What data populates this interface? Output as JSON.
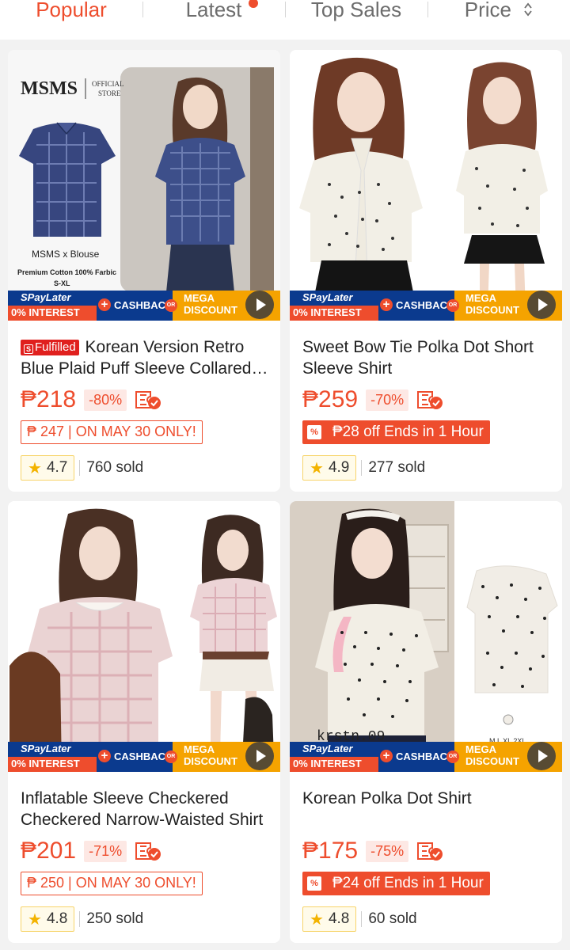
{
  "sort_bar": {
    "tabs": [
      {
        "label": "Popular"
      },
      {
        "label": "Latest"
      },
      {
        "label": "Top Sales"
      },
      {
        "label": "Price"
      }
    ]
  },
  "colors": {
    "accent": "#ee4d2d",
    "shopee_blue": "#0b3a8e",
    "mega_orange": "#f5a300"
  },
  "promo_strip": {
    "spaylater": "SPayLater",
    "interest": "0% INTEREST",
    "cashback": "CASHBACK",
    "or": "OR",
    "mega_line1": "MEGA",
    "mega_line2": "DISCOUNT"
  },
  "products": [
    {
      "image_texts": {
        "brand": "MSMS",
        "official_line1": "OFFICIAL",
        "official_line2": "STORE",
        "caption": "MSMS x Blouse",
        "fabric": "Premium Cotton 100% Farbic",
        "sizes": "S-XL"
      },
      "badge": "Fulfilled",
      "title": "Korean Version Retro Blue Plaid Puff Sleeve Collared Shirt",
      "price": "₱218",
      "discount": "-80%",
      "promo": "₱ 247 | ON MAY 30 ONLY!",
      "rating": "4.7",
      "sold": "760 sold"
    },
    {
      "title": "Sweet Bow Tie Polka Dot Short Sleeve Shirt",
      "price": "₱259",
      "discount": "-70%",
      "promo": "₱28 off Ends in 1 Hour",
      "rating": "4.9",
      "sold": "277 sold"
    },
    {
      "title": "Inflatable Sleeve Checkered Checkered Narrow-Waisted Shirt",
      "price": "₱201",
      "discount": "-71%",
      "promo": "₱ 250 | ON MAY 30 ONLY!",
      "rating": "4.8",
      "sold": "250 sold"
    },
    {
      "image_texts": {
        "watermark": "krstn.09",
        "sizes": "M L XL 2XL"
      },
      "title": "Korean Polka Dot Shirt",
      "price": "₱175",
      "discount": "-75%",
      "promo": "₱24 off Ends in 1 Hour",
      "rating": "4.8",
      "sold": "60 sold"
    }
  ]
}
